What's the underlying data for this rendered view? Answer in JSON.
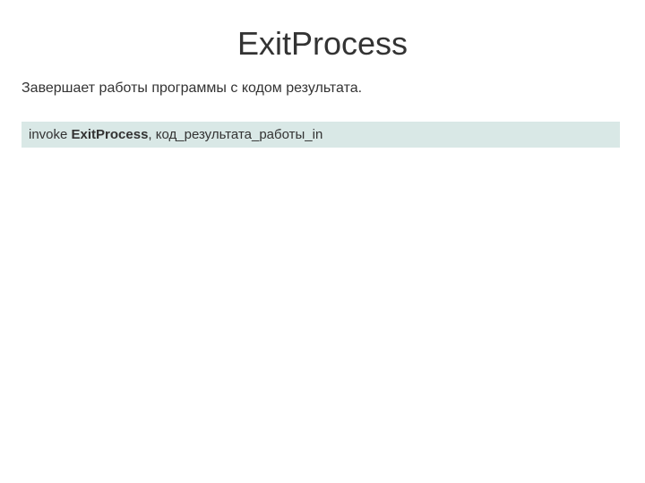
{
  "slide": {
    "title": "ExitProcess",
    "description": "Завершает работы программы с кодом результата.",
    "code": {
      "invoke": "invoke ",
      "funcname": "ExitProcess",
      "rest": ", код_результата_работы_in"
    }
  }
}
